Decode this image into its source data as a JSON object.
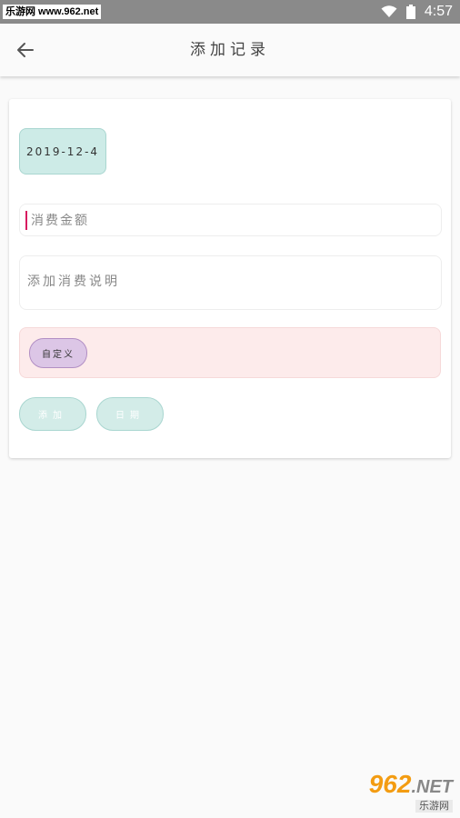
{
  "statusbar": {
    "site_watermark": "乐游网 www.962.net",
    "time": "4:57"
  },
  "appbar": {
    "title": "添加记录",
    "back_icon": "arrow-left-icon"
  },
  "form": {
    "date": "2019-12-4",
    "amount_placeholder": "消费金额",
    "amount_value": "",
    "description_placeholder": "添加消费说明",
    "description_value": "",
    "tags": [
      "自定义"
    ],
    "add_button": "添加",
    "date_button": "日期"
  },
  "watermark": {
    "number": "962",
    "suffix": ".NET",
    "sub": "乐游网"
  },
  "colors": {
    "date_chip": "#cdebe7",
    "tag_area": "#fdebeb",
    "tag_chip": "#dcc6e6",
    "buttons": "#d3ece8",
    "cursor": "#d81b60"
  }
}
